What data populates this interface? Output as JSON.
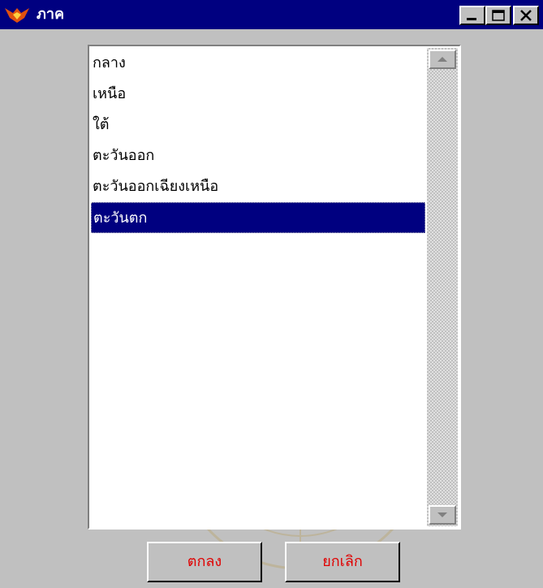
{
  "window": {
    "title": "ภาค",
    "controls": [
      "minimize",
      "maximize",
      "close"
    ]
  },
  "list": {
    "items": [
      "กลาง",
      "เหนือ",
      "ใต้",
      "ตะวันออก",
      "ตะวันออกเฉียงเหนือ",
      "ตะวันตก"
    ],
    "selected_index": 5
  },
  "buttons": {
    "ok_label": "ตกลง",
    "cancel_label": "ยกเลิก"
  },
  "colors": {
    "titlebar": "#000080",
    "selection": "#000080",
    "button_text": "#e00000",
    "face": "#c0c0c0"
  }
}
